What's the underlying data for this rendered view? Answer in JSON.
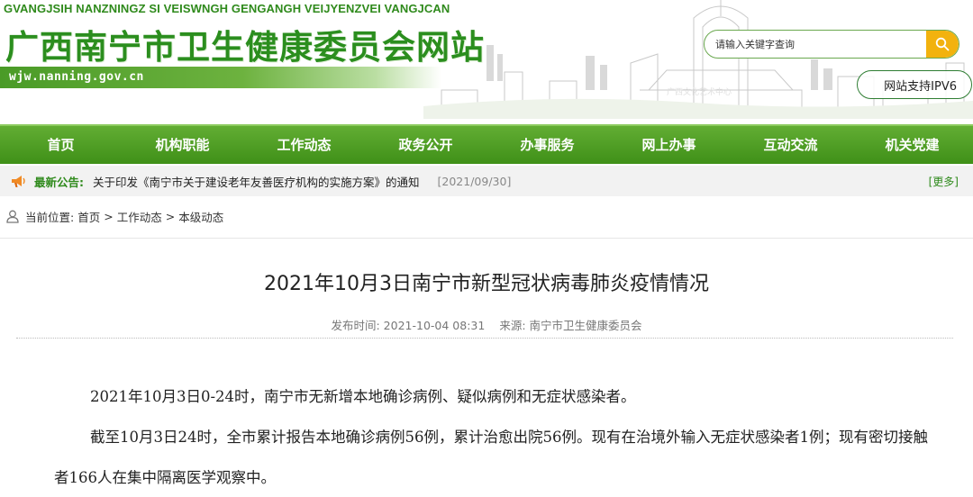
{
  "header": {
    "zhuang_title": "GVANGJSIH NANZNINGZ SI VEISWNGH GENGANGH VEIJYENZVEI VANGJCAN",
    "site_title": "广西南宁市卫生健康委员会网站",
    "domain": "wjw.nanning.gov.cn",
    "search_placeholder": "请输入关键字查询",
    "ipv6_label": "网站支持IPV6"
  },
  "nav": {
    "items": [
      {
        "label": "首页"
      },
      {
        "label": "机构职能"
      },
      {
        "label": "工作动态"
      },
      {
        "label": "政务公开"
      },
      {
        "label": "办事服务"
      },
      {
        "label": "网上办事"
      },
      {
        "label": "互动交流"
      },
      {
        "label": "机关党建"
      }
    ]
  },
  "notice": {
    "label": "最新公告:",
    "text": "关于印发《南宁市关于建设老年友善医疗机构的实施方案》的通知",
    "date": "[2021/09/30]",
    "more": "[更多]"
  },
  "breadcrumb": {
    "prefix": "当前位置:",
    "items": [
      "首页",
      ">",
      "工作动态",
      ">",
      "本级动态"
    ]
  },
  "article": {
    "title": "2021年10月3日南宁市新型冠状病毒肺炎疫情情况",
    "publish_time": "发布时间: 2021-10-04 08:31",
    "source": "来源: 南宁市卫生健康委员会",
    "paragraphs": [
      "2021年10月3日0-24时，南宁市无新增本地确诊病例、疑似病例和无症状感染者。",
      "截至10月3日24时，全市累计报告本地确诊病例56例，累计治愈出院56例。现有在治境外输入无症状感染者1例；现有密切接触者166人在集中隔离医学观察中。"
    ]
  },
  "colors": {
    "brand_green": "#2b8e1e",
    "nav_green": "#4a9b22",
    "search_accent": "#f2b20e"
  }
}
